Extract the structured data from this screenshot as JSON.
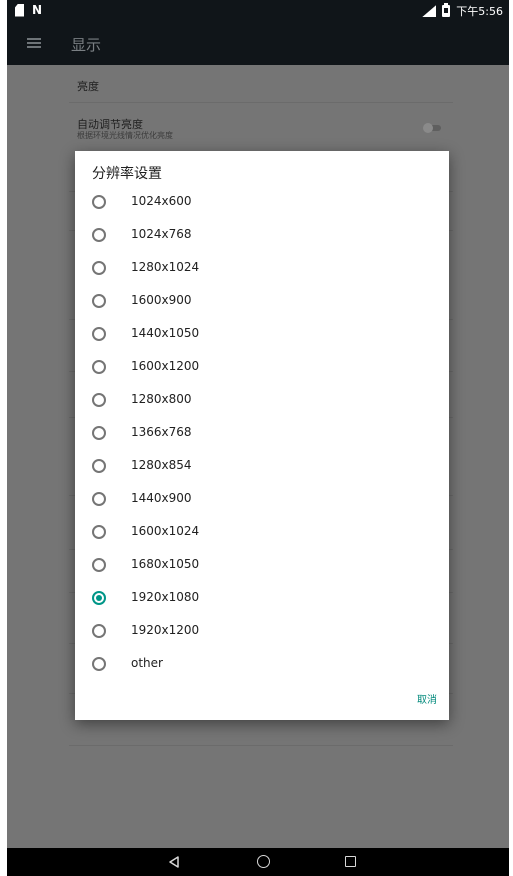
{
  "status_bar": {
    "left_icons": [
      "sim-card-icon",
      "nfc-icon"
    ],
    "nfc_glyph": "N",
    "right_icons": [
      "signal-icon",
      "battery-icon"
    ],
    "time": "下午5:56"
  },
  "app_bar": {
    "title": "显示"
  },
  "settings": {
    "items": [
      {
        "title": "亮度"
      },
      {
        "title": "自动调节亮度",
        "subtitle": "根据环境光线情况优化亮度",
        "toggle_on": false
      }
    ]
  },
  "dialog": {
    "title": "分辨率设置",
    "options": [
      {
        "label": "1024x600",
        "checked": false
      },
      {
        "label": "1024x768",
        "checked": false
      },
      {
        "label": "1280x1024",
        "checked": false
      },
      {
        "label": "1600x900",
        "checked": false
      },
      {
        "label": "1440x1050",
        "checked": false
      },
      {
        "label": "1600x1200",
        "checked": false
      },
      {
        "label": "1280x800",
        "checked": false
      },
      {
        "label": "1366x768",
        "checked": false
      },
      {
        "label": "1280x854",
        "checked": false
      },
      {
        "label": "1440x900",
        "checked": false
      },
      {
        "label": "1600x1024",
        "checked": false
      },
      {
        "label": "1680x1050",
        "checked": false
      },
      {
        "label": "1920x1080",
        "checked": true
      },
      {
        "label": "1920x1200",
        "checked": false
      },
      {
        "label": "other",
        "checked": false
      }
    ],
    "cancel_label": "取消"
  },
  "nav_bar": {
    "buttons": [
      "back-icon",
      "home-icon",
      "recents-icon"
    ]
  },
  "colors": {
    "accent": "#009688",
    "scrim": "#757575",
    "bar": "#101519"
  }
}
